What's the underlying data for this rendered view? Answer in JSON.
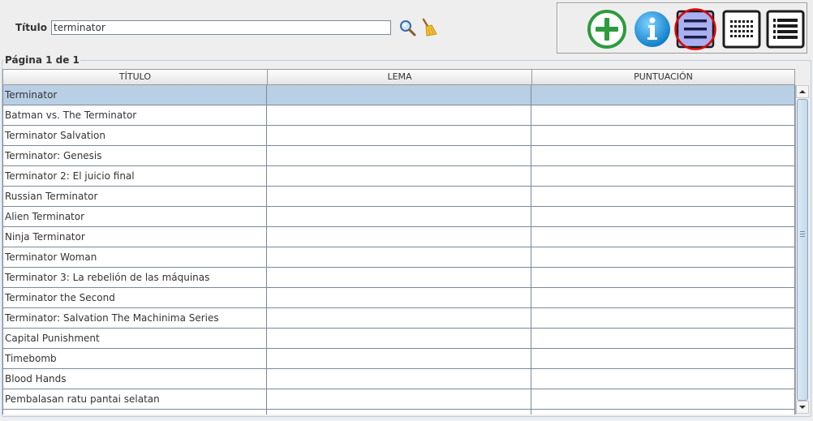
{
  "search": {
    "label": "Título",
    "value": "terminator",
    "search_icon": "magnifier-icon",
    "clear_icon": "broom-icon"
  },
  "toolbar": {
    "buttons": [
      {
        "name": "add",
        "icon": "plus-circle-icon",
        "color": "#2e9b3e"
      },
      {
        "name": "info",
        "icon": "info-circle-icon",
        "color": "#1e90d6"
      },
      {
        "name": "list-view",
        "icon": "list-view-icon",
        "selected": true
      },
      {
        "name": "grid-view",
        "icon": "grid-view-icon"
      },
      {
        "name": "detail-view",
        "icon": "detail-list-icon"
      }
    ],
    "highlight_color": "#e00000"
  },
  "panel": {
    "legend": "Página 1 de 1"
  },
  "table": {
    "columns": [
      "TÍTULO",
      "LEMA",
      "PUNTUACIÓN"
    ],
    "rows": [
      {
        "titulo": "Terminator",
        "lema": "",
        "puntuacion": ""
      },
      {
        "titulo": "Batman vs. The Terminator",
        "lema": "",
        "puntuacion": ""
      },
      {
        "titulo": "Terminator Salvation",
        "lema": "",
        "puntuacion": ""
      },
      {
        "titulo": "Terminator: Genesis",
        "lema": "",
        "puntuacion": ""
      },
      {
        "titulo": "Terminator 2: El juicio final",
        "lema": "",
        "puntuacion": ""
      },
      {
        "titulo": "Russian Terminator",
        "lema": "",
        "puntuacion": ""
      },
      {
        "titulo": "Alien Terminator",
        "lema": "",
        "puntuacion": ""
      },
      {
        "titulo": "Ninja Terminator",
        "lema": "",
        "puntuacion": ""
      },
      {
        "titulo": "Terminator Woman",
        "lema": "",
        "puntuacion": ""
      },
      {
        "titulo": "Terminator 3: La rebelión de las máquinas",
        "lema": "",
        "puntuacion": ""
      },
      {
        "titulo": "Terminator the Second",
        "lema": "",
        "puntuacion": ""
      },
      {
        "titulo": "Terminator: Salvation The Machinima Series",
        "lema": "",
        "puntuacion": ""
      },
      {
        "titulo": "Capital Punishment",
        "lema": "",
        "puntuacion": ""
      },
      {
        "titulo": "Timebomb",
        "lema": "",
        "puntuacion": ""
      },
      {
        "titulo": "Blood Hands",
        "lema": "",
        "puntuacion": ""
      },
      {
        "titulo": "Pembalasan ratu pantai selatan",
        "lema": "",
        "puntuacion": ""
      },
      {
        "titulo": "",
        "lema": "",
        "puntuacion": ""
      }
    ],
    "selected_row": 0,
    "selection_color": "#b8cfe5"
  }
}
